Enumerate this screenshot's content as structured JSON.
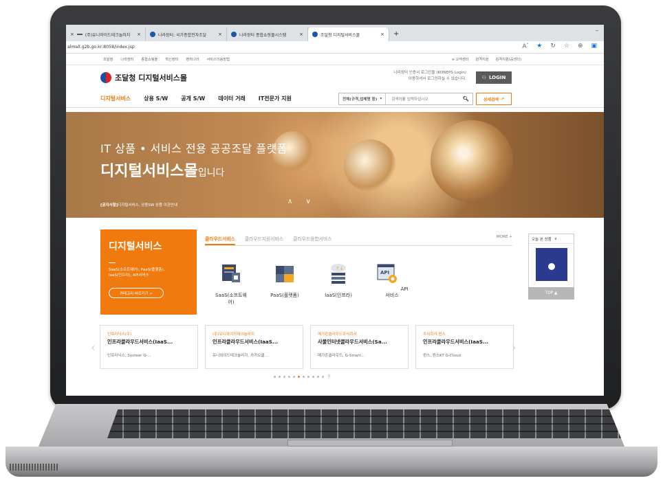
{
  "browser": {
    "tabs": [
      {
        "label": "(주)유니와이드테크놀러지",
        "active": false
      },
      {
        "label": "나라장터: 국가종합전자조달",
        "active": false
      },
      {
        "label": "나라장터 종합쇼핑몰시스템",
        "active": false
      },
      {
        "label": "조달청 디지털서비스몰",
        "active": true
      }
    ],
    "url": "almall.g2b.go.kr:8058/index.jsp"
  },
  "util_nav": {
    "left": [
      "조달청",
      "나라장터",
      "종합쇼핑몰",
      "혁신장터",
      "벤처나라",
      "서비스이용방법"
    ],
    "right": [
      "e-고객센터",
      "원격지원",
      "원격지원(공센터)"
    ]
  },
  "header": {
    "logo_text": "조달청 디지털서비스몰",
    "login_note_1": "나라장터 인증서 로그인을 (KONEPS Login)",
    "login_note_2": "이용하셔서 로그인하실 수 있습니다.",
    "login_label": "LOGIN"
  },
  "gnb": {
    "items": [
      "디지털서비스",
      "상용 S/W",
      "공개 S/W",
      "데이터 거래",
      "IT전문가 지원"
    ],
    "search_select": "전체(규격,업체명 등)",
    "search_placeholder": "검색어를 입력하십시오",
    "detail_search": "상세검색"
  },
  "banner": {
    "line1": "IT 상품 • 서비스 전용 공공조달 플랫폼",
    "line2_bold": "디지털서비스몰",
    "line2_rest": "입니다",
    "notice_tag": "[공지사항]",
    "notice_text": "디지털서비스, 상용SW 상품 이관안내",
    "arrows": "∧ ∨"
  },
  "digital_service": {
    "title": "디지털서비스",
    "desc_1": "SaaS(소프트웨어), PaaS(플랫폼),",
    "desc_2": "IaaS(인프라), API서비스",
    "button": "카테고리 바로가기 >"
  },
  "service_tabs": {
    "tabs": [
      "클라우드서비스",
      "클라우드지원서비스",
      "클라우드융합서비스"
    ],
    "more": "MORE +",
    "items": [
      "SaaS(소프트웨어)",
      "PaaS(플랫폼)",
      "IaaS(인프라)",
      "API서비스"
    ]
  },
  "today": {
    "title": "오늘 본 상품",
    "top": "TOP ▲"
  },
  "cards": [
    {
      "company": "인프라닉스(주)",
      "name": "인프라클라우드서비스(IaaS...",
      "sub": "인프라닉스, Systeer G-..."
    },
    {
      "company": "(주)유니와이드테크놀러지",
      "name": "인프라클라우드서비스(IaaS...",
      "sub": "유니와이드테크놀러지, 카카오클..."
    },
    {
      "company": "메가존클라우드주식회사",
      "name": "사물인터넷클라우드서비스(Sa...",
      "sub": "메가존클라우드, G-Smart..."
    },
    {
      "company": "주식회사 윈스",
      "name": "인프라클라우드서비스(IaaS...",
      "sub": "윈스, 윈스KT G-Cloud"
    }
  ],
  "pagination": {
    "count": 11,
    "active": 5,
    "end_glyph": "II"
  },
  "colors": {
    "accent": "#f07a0e",
    "brand_blue": "#1c4fa0"
  }
}
